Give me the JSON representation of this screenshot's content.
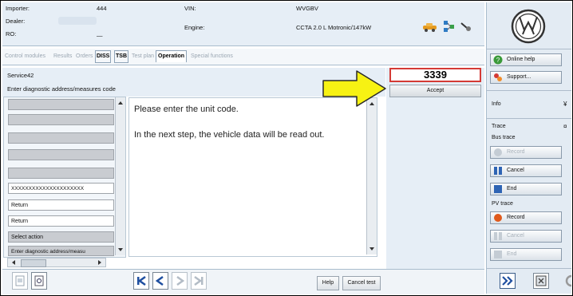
{
  "header": {
    "importer_label": "Importer:",
    "importer_value": "444",
    "dealer_label": "Dealer:",
    "ro_label": "RO:",
    "ro_value": "—",
    "vin_label": "VIN:",
    "vin_value": "WVGBV",
    "engine_label": "Engine:",
    "engine_value": "CCTA 2.0 L Motronic/147kW"
  },
  "tabs": [
    {
      "label": "Control modules"
    },
    {
      "label": "Results"
    },
    {
      "label": "Orders"
    },
    {
      "label": "DISS"
    },
    {
      "label": "TSB"
    },
    {
      "label": "Test plan"
    },
    {
      "label": "Operation"
    },
    {
      "label": "Special functions"
    }
  ],
  "info": {
    "service": "Service42",
    "instruction": "Enter diagnostic address/measures code"
  },
  "code_entry": {
    "value": "3339",
    "accept_label": "Accept"
  },
  "left_list": {
    "items": [
      "",
      "",
      "",
      "",
      "",
      "XXXXXXXXXXXXXXXXXXXXX",
      "Return",
      "Return",
      "Select action",
      "Enter diagnostic address/measu"
    ]
  },
  "content": {
    "line1": "Please enter the unit code.",
    "line2": "In the next step, the vehicle data will be read out."
  },
  "bottom": {
    "help_label": "Help",
    "cancel_test_label": "Cancel test"
  },
  "sidebar": {
    "online_help": "Online help",
    "support": "Support...",
    "info_label": "Info",
    "trace_label": "Trace",
    "bus_trace_label": "Bus trace",
    "bus_record": "Record",
    "bus_cancel": "Cancel",
    "bus_end": "End",
    "pv_trace_label": "PV trace",
    "pv_record": "Record",
    "pv_cancel": "Cancel",
    "pv_end": "End"
  },
  "colors": {
    "highlight_red": "#d43a35",
    "arrow_yellow": "#f7f213",
    "nav_blue": "#1f4fa0"
  },
  "icons": [
    "car-icon",
    "network-icon",
    "cable-icon",
    "vw-logo-icon",
    "arrow-pointer-icon",
    "first-page-icon",
    "prev-page-icon",
    "next-page-icon",
    "last-page-icon",
    "forward-icon",
    "screenshot-icon"
  ]
}
